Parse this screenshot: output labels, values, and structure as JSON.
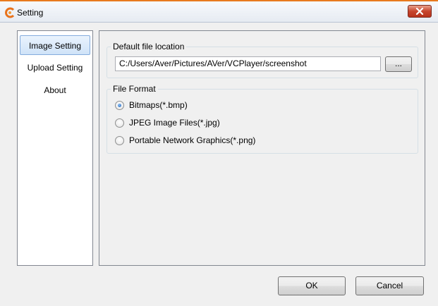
{
  "window": {
    "title": "Setting",
    "close_icon": "close-icon",
    "accent_color": "#e87a1e"
  },
  "sidebar": {
    "items": [
      {
        "label": "Image Setting",
        "selected": true
      },
      {
        "label": "Upload Setting",
        "selected": false
      },
      {
        "label": "About",
        "selected": false
      }
    ]
  },
  "default_location": {
    "legend": "Default file location",
    "path_value": "C:/Users/Aver/Pictures/AVer/VCPlayer/screenshot",
    "browse_label": "..."
  },
  "file_format": {
    "legend": "File Format",
    "options": [
      {
        "label": "Bitmaps(*.bmp)",
        "checked": true
      },
      {
        "label": "JPEG Image Files(*.jpg)",
        "checked": false
      },
      {
        "label": "Portable Network Graphics(*.png)",
        "checked": false
      }
    ]
  },
  "footer": {
    "ok_label": "OK",
    "cancel_label": "Cancel"
  }
}
